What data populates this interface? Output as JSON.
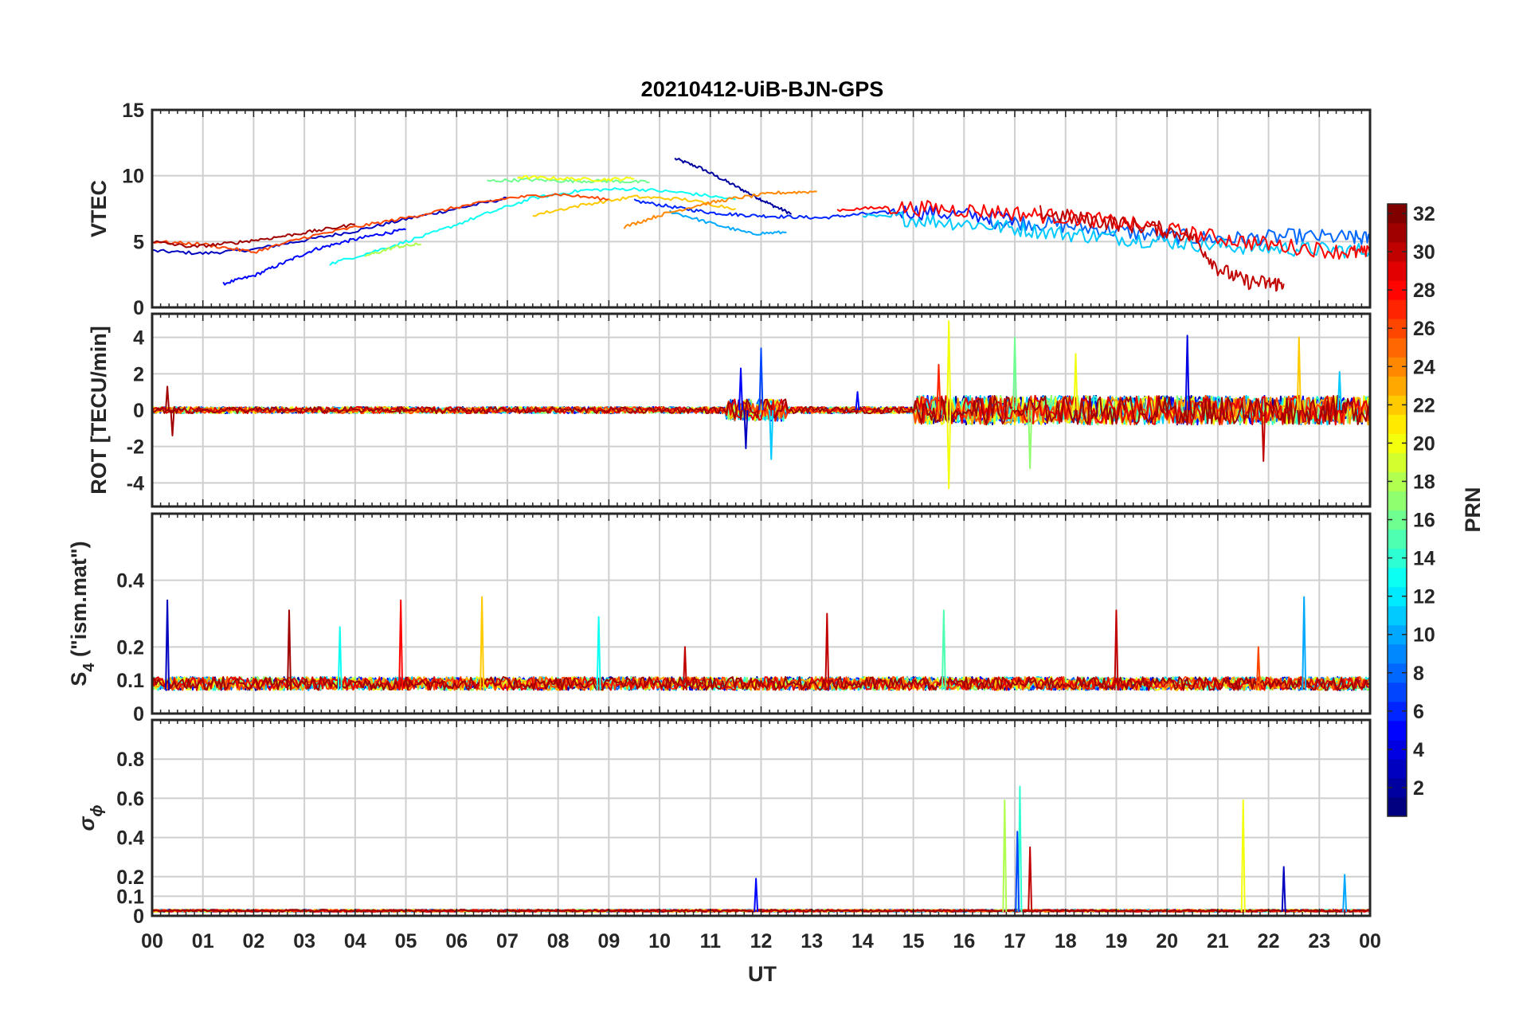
{
  "title": "20210412-UiB-BJN-GPS",
  "x_axis": {
    "label": "UT",
    "ticks": [
      "00",
      "01",
      "02",
      "03",
      "04",
      "05",
      "06",
      "07",
      "08",
      "09",
      "10",
      "11",
      "12",
      "13",
      "14",
      "15",
      "16",
      "17",
      "18",
      "19",
      "20",
      "21",
      "22",
      "23",
      "00"
    ]
  },
  "colorbar": {
    "label": "PRN",
    "ticks": [
      "2",
      "4",
      "6",
      "8",
      "10",
      "12",
      "14",
      "16",
      "18",
      "20",
      "22",
      "24",
      "26",
      "28",
      "30",
      "32"
    ],
    "colormap": "jet",
    "range": [
      1,
      32
    ]
  },
  "panels": [
    {
      "id": "vtec",
      "ylabel": "VTEC",
      "ylim": [
        0,
        15
      ],
      "yticks": [
        "0",
        "5",
        "10",
        "15"
      ],
      "ytick_values": [
        0,
        5,
        10,
        15
      ]
    },
    {
      "id": "rot",
      "ylabel": "ROT [TECU/min]",
      "ylim": [
        -5.3,
        5.3
      ],
      "yticks": [
        "-4",
        "-2",
        "0",
        "2",
        "4"
      ],
      "ytick_values": [
        -4,
        -2,
        0,
        2,
        4
      ]
    },
    {
      "id": "s4",
      "ylabel_main": "S",
      "ylabel_sub": "4",
      "ylabel_rest": " (\"ism.mat\")",
      "ylim": [
        0,
        0.6
      ],
      "yticks": [
        "0",
        "0.1",
        "0.2",
        "0.4"
      ],
      "ytick_values": [
        0,
        0.1,
        0.2,
        0.4
      ]
    },
    {
      "id": "sigphi",
      "ylabel_main": "σ",
      "ylabel_sub": "ϕ",
      "ylim": [
        0,
        1
      ],
      "yticks": [
        "0",
        "0.1",
        "0.2",
        "0.4",
        "0.6",
        "0.8"
      ],
      "ytick_values": [
        0,
        0.1,
        0.2,
        0.4,
        0.6,
        0.8
      ]
    }
  ],
  "chart_data": [
    {
      "type": "line",
      "panel": "vtec",
      "xlabel": "UT",
      "ylabel": "VTEC",
      "ylim": [
        0,
        15
      ],
      "xlim": [
        0,
        24
      ],
      "series": [
        {
          "prn": 2,
          "x": [
            10.3,
            10.8,
            11.3,
            11.8,
            12.2,
            12.6
          ],
          "y": [
            11.3,
            10.6,
            9.6,
            8.6,
            7.8,
            7.1
          ]
        },
        {
          "prn": 3,
          "x": [
            0,
            1,
            2,
            3,
            4,
            5,
            6,
            7
          ],
          "y": [
            4.3,
            4.1,
            4.4,
            5.1,
            5.8,
            6.7,
            7.5,
            8.3
          ]
        },
        {
          "prn": 5,
          "x": [
            1.4,
            2.0,
            2.6,
            3.2,
            3.8,
            4.4,
            5.0
          ],
          "y": [
            1.8,
            2.4,
            3.4,
            4.4,
            5.0,
            5.5,
            5.9
          ]
        },
        {
          "prn": 6,
          "x": [
            9.5,
            10.3,
            11.0,
            11.7,
            12.4,
            13.2,
            14.0,
            15.0,
            16.0,
            17.0
          ],
          "y": [
            8.1,
            7.6,
            7.2,
            7.0,
            6.9,
            6.8,
            7.1,
            7.3,
            7.0,
            6.8
          ]
        },
        {
          "prn": 8,
          "x": [
            16.5,
            17.5,
            18.5,
            19.5,
            20.5,
            21.5,
            22.5,
            23.5,
            24
          ],
          "y": [
            6.6,
            6.4,
            6.0,
            5.6,
            5.3,
            5.2,
            5.4,
            5.3,
            5.2
          ]
        },
        {
          "prn": 10,
          "x": [
            10.2,
            11.0,
            11.8,
            12.5
          ],
          "y": [
            7.3,
            6.4,
            5.6,
            5.7
          ]
        },
        {
          "prn": 11,
          "x": [
            14.0,
            15.0,
            16.0,
            17.0,
            18.0,
            19.0,
            20.0,
            21.0,
            22.0,
            23.0,
            24.0
          ],
          "y": [
            7.0,
            6.7,
            6.4,
            6.0,
            5.6,
            5.3,
            5.0,
            4.7,
            4.5,
            4.4,
            4.3
          ]
        },
        {
          "prn": 13,
          "x": [
            3.5,
            4.5,
            5.5,
            6.5,
            7.5,
            8.5,
            9.5,
            10.5,
            11.5
          ],
          "y": [
            3.3,
            4.4,
            5.6,
            7.0,
            8.3,
            8.9,
            9.0,
            8.7,
            8.2
          ]
        },
        {
          "prn": 16,
          "x": [
            6.6,
            7.4,
            8.2,
            9.0,
            9.8
          ],
          "y": [
            9.6,
            9.7,
            9.6,
            9.6,
            9.5
          ]
        },
        {
          "prn": 18,
          "x": [
            4.2,
            4.8,
            5.3
          ],
          "y": [
            3.9,
            4.6,
            4.8
          ]
        },
        {
          "prn": 20,
          "x": [
            7.2,
            8.0,
            8.8,
            9.5
          ],
          "y": [
            9.9,
            9.8,
            9.7,
            9.8
          ]
        },
        {
          "prn": 22,
          "x": [
            7.5,
            8.5,
            9.5,
            10.5,
            11.5
          ],
          "y": [
            7.0,
            7.8,
            8.4,
            8.2,
            7.5
          ]
        },
        {
          "prn": 24,
          "x": [
            9.3,
            10.0,
            10.8,
            11.5,
            12.3,
            13.1
          ],
          "y": [
            6.1,
            7.0,
            7.8,
            8.3,
            8.7,
            8.8
          ]
        },
        {
          "prn": 26,
          "x": [
            0,
            1,
            2,
            3,
            4,
            5,
            6,
            7,
            8,
            9
          ],
          "y": [
            5.0,
            4.8,
            4.2,
            5.3,
            6.1,
            6.8,
            7.6,
            8.3,
            8.6,
            8.2
          ]
        },
        {
          "prn": 28,
          "x": [
            13.5,
            14.5,
            15.5,
            16.5,
            17.5,
            18.5,
            19.5,
            20.5,
            21.5,
            22.5,
            23.5,
            24
          ],
          "y": [
            7.4,
            7.6,
            7.5,
            7.3,
            7.0,
            6.7,
            6.2,
            5.6,
            5.0,
            4.6,
            4.2,
            4.1
          ]
        },
        {
          "prn": 30,
          "x": [
            17.5,
            18.3,
            19.0,
            19.8,
            20.5,
            21.0,
            21.5,
            22.0,
            22.3
          ],
          "y": [
            7.2,
            6.7,
            6.4,
            6.0,
            5.4,
            3.0,
            2.0,
            1.8,
            1.8
          ]
        },
        {
          "prn": 31,
          "x": [
            0,
            0.8,
            1.6,
            2.4,
            3.2,
            4.0
          ],
          "y": [
            5.0,
            4.6,
            4.9,
            5.3,
            5.8,
            6.3
          ]
        }
      ]
    },
    {
      "type": "line",
      "panel": "rot",
      "ylabel": "ROT [TECU/min]",
      "ylim": [
        -5.3,
        5.3
      ],
      "xlim": [
        0,
        24
      ],
      "peaks": [
        {
          "prn": 31,
          "x": 0.3,
          "y": 1.3
        },
        {
          "prn": 31,
          "x": 0.4,
          "y": -1.4
        },
        {
          "prn": 5,
          "x": 11.6,
          "y": 2.3
        },
        {
          "prn": 3,
          "x": 11.7,
          "y": -2.1
        },
        {
          "prn": 7,
          "x": 12.0,
          "y": 3.4
        },
        {
          "prn": 11,
          "x": 12.2,
          "y": -2.7
        },
        {
          "prn": 5,
          "x": 13.9,
          "y": 1.0
        },
        {
          "prn": 20,
          "x": 15.7,
          "y": 4.9
        },
        {
          "prn": 20,
          "x": 15.7,
          "y": -4.3
        },
        {
          "prn": 27,
          "x": 15.5,
          "y": 2.5
        },
        {
          "prn": 16,
          "x": 17.0,
          "y": 4.0
        },
        {
          "prn": 17,
          "x": 17.3,
          "y": -3.2
        },
        {
          "prn": 20,
          "x": 18.2,
          "y": 3.1
        },
        {
          "prn": 4,
          "x": 20.4,
          "y": 4.1
        },
        {
          "prn": 22,
          "x": 22.6,
          "y": 4.0
        },
        {
          "prn": 30,
          "x": 21.9,
          "y": -2.8
        },
        {
          "prn": 11,
          "x": 23.4,
          "y": 2.1
        }
      ]
    },
    {
      "type": "line",
      "panel": "s4",
      "ylabel": "S4 (\"ism.mat\")",
      "ylim": [
        0,
        0.6
      ],
      "xlim": [
        0,
        24
      ],
      "peaks": [
        {
          "prn": 3,
          "x": 0.3,
          "y": 0.34
        },
        {
          "prn": 31,
          "x": 2.7,
          "y": 0.31
        },
        {
          "prn": 13,
          "x": 3.7,
          "y": 0.26
        },
        {
          "prn": 28,
          "x": 4.9,
          "y": 0.34
        },
        {
          "prn": 22,
          "x": 6.5,
          "y": 0.35
        },
        {
          "prn": 13,
          "x": 8.8,
          "y": 0.29
        },
        {
          "prn": 30,
          "x": 10.5,
          "y": 0.2
        },
        {
          "prn": 30,
          "x": 13.3,
          "y": 0.3
        },
        {
          "prn": 15,
          "x": 15.6,
          "y": 0.31
        },
        {
          "prn": 30,
          "x": 19.0,
          "y": 0.31
        },
        {
          "prn": 10,
          "x": 22.7,
          "y": 0.35
        },
        {
          "prn": 26,
          "x": 21.8,
          "y": 0.2
        }
      ]
    },
    {
      "type": "line",
      "panel": "sigphi",
      "ylabel": "σϕ",
      "ylim": [
        0,
        1
      ],
      "xlim": [
        0,
        24
      ],
      "peaks": [
        {
          "prn": 5,
          "x": 11.9,
          "y": 0.19
        },
        {
          "prn": 18,
          "x": 16.8,
          "y": 0.59
        },
        {
          "prn": 14,
          "x": 17.1,
          "y": 0.66
        },
        {
          "prn": 7,
          "x": 17.05,
          "y": 0.43
        },
        {
          "prn": 30,
          "x": 17.3,
          "y": 0.35
        },
        {
          "prn": 20,
          "x": 21.5,
          "y": 0.59
        },
        {
          "prn": 3,
          "x": 22.3,
          "y": 0.25
        },
        {
          "prn": 10,
          "x": 23.5,
          "y": 0.21
        }
      ]
    }
  ]
}
